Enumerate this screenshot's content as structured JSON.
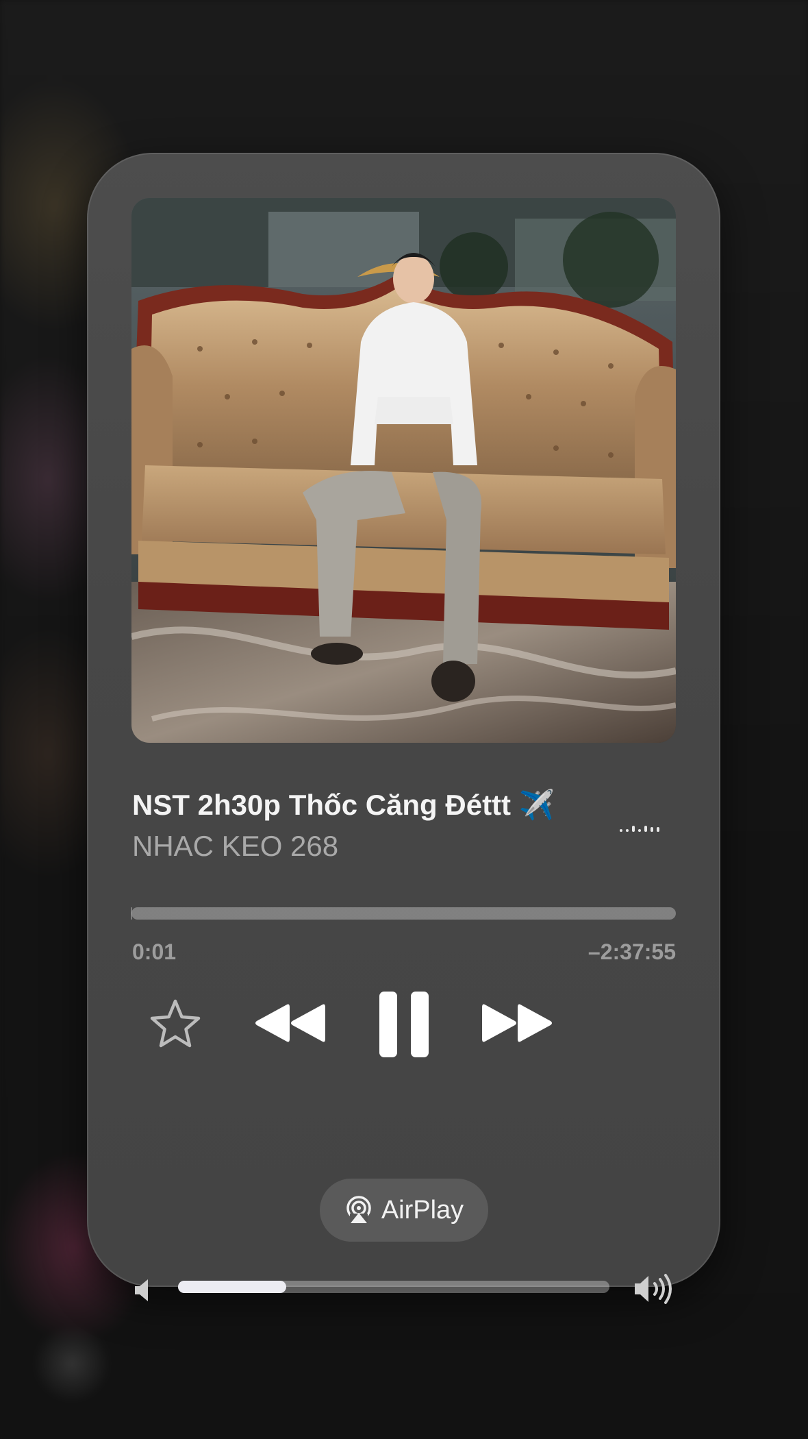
{
  "now_playing": {
    "title": "NST 2h30p Thốc Căng Đéttt ✈️",
    "artist": "NHAC KEO 268",
    "elapsed": "0:01",
    "remaining": "–2:37:55",
    "progress_fraction": 0.001,
    "artwork_icon": "album-artwork"
  },
  "controls": {
    "favorite_icon": "star-icon",
    "previous_icon": "rewind-icon",
    "playpause_icon": "pause-icon",
    "next_icon": "fast-forward-icon"
  },
  "volume": {
    "level_fraction": 0.25,
    "low_icon": "speaker-low-icon",
    "high_icon": "speaker-high-icon"
  },
  "airplay": {
    "label": "AirPlay",
    "icon": "airplay-icon"
  },
  "colors": {
    "card_bg": "#474747",
    "text_primary": "#f4f4f4",
    "volume_fill": "#ececf2"
  }
}
